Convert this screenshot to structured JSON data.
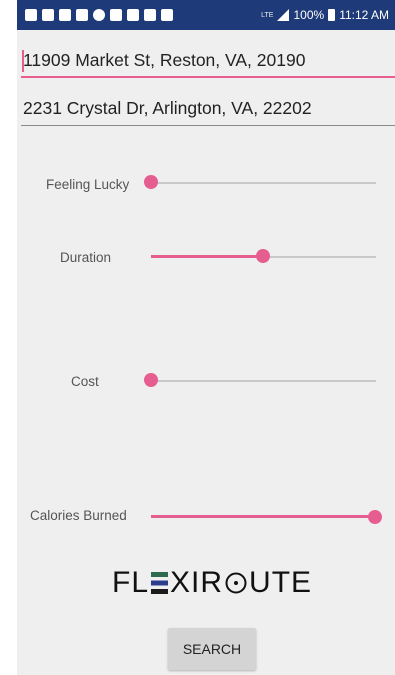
{
  "status_bar": {
    "icons": [
      "message-icon",
      "calendar-icon",
      "facebook-icon",
      "news-icon",
      "messenger-icon",
      "chat-icon",
      "gallery-icon",
      "usb-icon",
      "image-icon"
    ],
    "network": "LTE",
    "battery_text": "100%",
    "time": "11:12 AM"
  },
  "form": {
    "origin": "11909 Market St, Reston, VA, 20190",
    "destination": "2231 Crystal Dr, Arlington, VA, 22202"
  },
  "sliders": [
    {
      "label": "Feeling Lucky",
      "value": 0.0
    },
    {
      "label": "Duration",
      "value": 0.5
    },
    {
      "label": "Cost",
      "value": 0.0
    },
    {
      "label": "Calories Burned",
      "value": 1.0
    }
  ],
  "logo": {
    "prefix": "FL",
    "middle": "XIR",
    "suffix": "UTE"
  },
  "search_button": "SEARCH",
  "colors": {
    "accent": "#e65e90",
    "status_bar": "#1f3a78",
    "track": "#c9c9c9"
  }
}
